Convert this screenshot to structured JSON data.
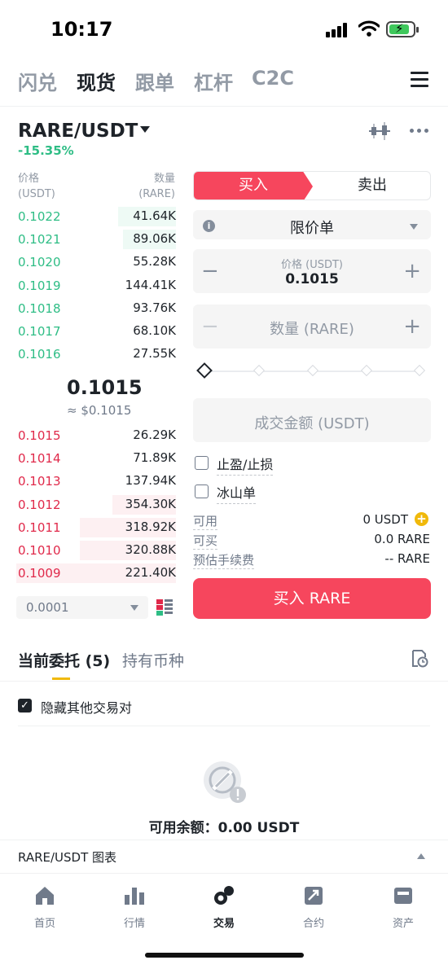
{
  "status_bar": {
    "time": "10:17"
  },
  "top_nav": {
    "tabs": [
      "闪兑",
      "现货",
      "跟单",
      "杠杆",
      "C2C"
    ],
    "active": "现货"
  },
  "pair": {
    "symbol": "RARE/USDT",
    "change": "-15.35%"
  },
  "order_book": {
    "price_header": "价格",
    "price_unit": "(USDT)",
    "qty_header": "数量",
    "qty_unit": "(RARE)",
    "bids": [
      {
        "price": "0.1022",
        "qty": "41.64K",
        "depth": 0.36
      },
      {
        "price": "0.1021",
        "qty": "89.06K",
        "depth": 0.33
      },
      {
        "price": "0.1020",
        "qty": "55.28K",
        "depth": 0
      },
      {
        "price": "0.1019",
        "qty": "144.41K",
        "depth": 0
      },
      {
        "price": "0.1018",
        "qty": "93.76K",
        "depth": 0
      },
      {
        "price": "0.1017",
        "qty": "68.10K",
        "depth": 0
      },
      {
        "price": "0.1016",
        "qty": "27.55K",
        "depth": 0
      }
    ],
    "mid_price": "0.1015",
    "mid_price_usd": "≈ $0.1015",
    "asks": [
      {
        "price": "0.1015",
        "qty": "26.29K",
        "depth": 0
      },
      {
        "price": "0.1014",
        "qty": "71.89K",
        "depth": 0
      },
      {
        "price": "0.1013",
        "qty": "137.94K",
        "depth": 0
      },
      {
        "price": "0.1012",
        "qty": "354.30K",
        "depth": 0.4
      },
      {
        "price": "0.1011",
        "qty": "318.92K",
        "depth": 0.6
      },
      {
        "price": "0.1010",
        "qty": "320.88K",
        "depth": 0.6
      },
      {
        "price": "0.1009",
        "qty": "221.40K",
        "depth": 1.0
      }
    ],
    "depth_step": "0.0001"
  },
  "order_form": {
    "buy_tab": "买入",
    "sell_tab": "卖出",
    "order_type": "限价单",
    "price_label": "价格 (USDT)",
    "price_value": "0.1015",
    "qty_placeholder": "数量 (RARE)",
    "total_placeholder": "成交金额 (USDT)",
    "tpsl_label": "止盈/止损",
    "iceberg_label": "冰山单",
    "available_label": "可用",
    "available_value": "0 USDT",
    "can_buy_label": "可买",
    "can_buy_value": "0.0 RARE",
    "fee_label": "预估手续费",
    "fee_value": "-- RARE",
    "buy_button": "买入 RARE",
    "plus": "+",
    "minus": "−"
  },
  "orders": {
    "tab_current": "当前委托 (5)",
    "tab_holdings": "持有币种",
    "hide_other": "隐藏其他交易对",
    "available_balance": "可用余额：0.00 USDT"
  },
  "chart_bar": {
    "label": "RARE/USDT 图表"
  },
  "bottom_nav": {
    "items": [
      "首页",
      "行情",
      "交易",
      "合约",
      "资产"
    ],
    "active": "交易"
  },
  "colors": {
    "bid": "#2ebd85",
    "ask": "#e0294a",
    "buy": "#f6465d",
    "accent": "#f0b90b"
  }
}
